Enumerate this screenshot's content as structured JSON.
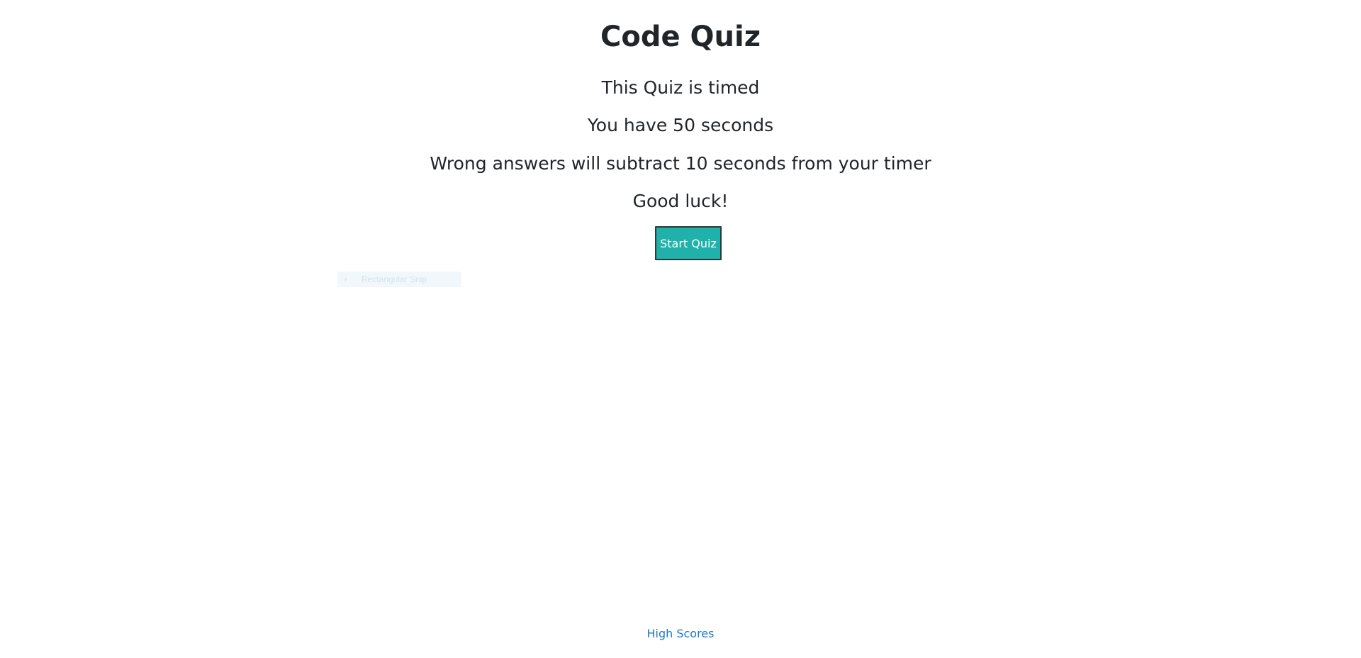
{
  "intro": {
    "title": "Code Quiz",
    "line1": "This Quiz is timed",
    "line2": "You have 50 seconds",
    "line3": "Wrong answers will subtract 10 seconds from your timer",
    "line4": "Good luck!"
  },
  "actions": {
    "start_label": "Start Quiz"
  },
  "overlay": {
    "icon": "plus-icon",
    "label": "Rectangular Snip"
  },
  "footer": {
    "high_scores_label": "High Scores"
  },
  "colors": {
    "button_bg": "#20b2aa",
    "link": "#1e78d0",
    "text": "#212529"
  }
}
